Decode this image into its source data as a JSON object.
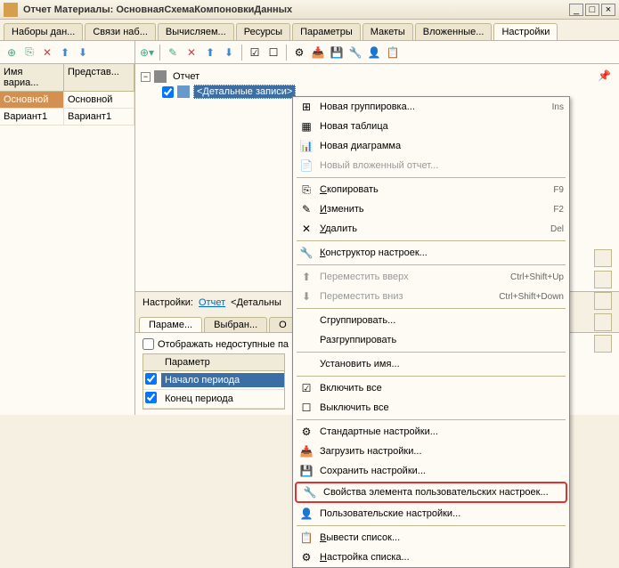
{
  "title": "Отчет Материалы: ОсновнаяСхемаКомпоновкиДанных",
  "winbtns": {
    "min": "_",
    "max": "□",
    "close": "×"
  },
  "tabs": [
    "Наборы дан...",
    "Связи наб...",
    "Вычисляем...",
    "Ресурсы",
    "Параметры",
    "Макеты",
    "Вложенные...",
    "Настройки"
  ],
  "activeTab": 7,
  "left": {
    "cols": [
      "Имя вариа...",
      "Представ..."
    ],
    "rows": [
      {
        "name": "Основной",
        "pres": "Основной",
        "selected": true
      },
      {
        "name": "Вариант1",
        "pres": "Вариант1",
        "selected": false
      }
    ]
  },
  "tree": {
    "root": "Отчет",
    "child": "<Детальные записи>"
  },
  "settingsBar": {
    "label": "Настройки:",
    "link1": "Отчет",
    "link2": "<Детальны"
  },
  "bottomTabs": [
    "Параме...",
    "Выбран...",
    "О"
  ],
  "paramsCheck": "Отображать недоступные па",
  "paramsHeader": "Параметр",
  "params": [
    {
      "label": "Начало периода",
      "checked": true,
      "sel": true
    },
    {
      "label": "Конец периода",
      "checked": true,
      "sel": false
    }
  ],
  "menu": [
    {
      "icon": "⊞",
      "label": "Новая группировка...",
      "shortcut": "Ins"
    },
    {
      "icon": "▦",
      "label": "Новая таблица"
    },
    {
      "icon": "📊",
      "label": "Новая диаграмма"
    },
    {
      "icon": "📄",
      "label": "Новый вложенный отчет...",
      "disabled": true
    },
    {
      "sep": true
    },
    {
      "icon": "⎘",
      "label": "Скопировать",
      "shortcut": "F9",
      "u": "С"
    },
    {
      "icon": "✎",
      "label": "Изменить",
      "shortcut": "F2",
      "u": "И"
    },
    {
      "icon": "✕",
      "label": "Удалить",
      "shortcut": "Del",
      "u": "У"
    },
    {
      "sep": true
    },
    {
      "icon": "🔧",
      "label": "Конструктор настроек...",
      "u": "К"
    },
    {
      "sep": true
    },
    {
      "icon": "⬆",
      "label": "Переместить вверх",
      "shortcut": "Ctrl+Shift+Up",
      "disabled": true
    },
    {
      "icon": "⬇",
      "label": "Переместить вниз",
      "shortcut": "Ctrl+Shift+Down",
      "disabled": true
    },
    {
      "sep": true
    },
    {
      "label": "Сгруппировать..."
    },
    {
      "label": "Разгруппировать"
    },
    {
      "sep": true
    },
    {
      "label": "Установить имя..."
    },
    {
      "sep": true
    },
    {
      "icon": "☑",
      "label": "Включить все"
    },
    {
      "icon": "☐",
      "label": "Выключить все"
    },
    {
      "sep": true
    },
    {
      "icon": "⚙",
      "label": "Стандартные настройки..."
    },
    {
      "icon": "📥",
      "label": "Загрузить настройки..."
    },
    {
      "icon": "💾",
      "label": "Сохранить настройки..."
    },
    {
      "icon": "🔧",
      "label": "Свойства элемента пользовательских настроек...",
      "highlighted": true
    },
    {
      "icon": "👤",
      "label": "Пользовательские настройки..."
    },
    {
      "sep": true
    },
    {
      "icon": "📋",
      "label": "Вывести список...",
      "u": "В"
    },
    {
      "icon": "⚙",
      "label": "Настройка списка...",
      "u": "Н"
    }
  ]
}
